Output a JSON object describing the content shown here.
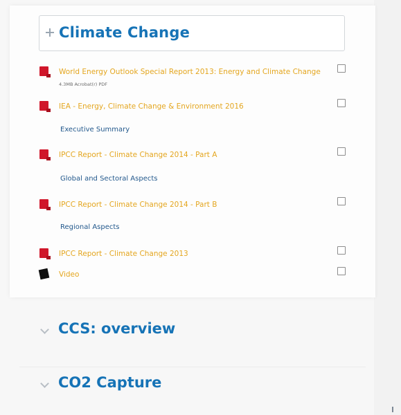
{
  "sections": {
    "climate_change": {
      "title": "Climate Change",
      "documents": [
        {
          "title": "World Energy Outlook Special Report 2013: Energy and Climate Change",
          "meta": "4.3MB Acrobat(r) PDF"
        },
        {
          "title": "IEA - Energy, Climate Change & Environment 2016",
          "subtitle": "Executive Summary"
        },
        {
          "title": "IPCC Report - Climate Change 2014 - Part A",
          "subtitle": "Global and Sectoral Aspects"
        },
        {
          "title": "IPCC Report - Climate Change 2014 - Part B",
          "subtitle": "Regional Aspects"
        },
        {
          "title": "IPCC Report - Climate Change 2013"
        },
        {
          "title": "Video"
        }
      ]
    },
    "ccs_overview": {
      "title": "CCS: overview"
    },
    "co2_capture": {
      "title": "CO2 Capture"
    }
  },
  "colors": {
    "section_title": "#1673b6",
    "document_link": "#e4a61f",
    "subtitle": "#22588c",
    "pdf_icon": "#d0162a",
    "video_icon": "#101010"
  },
  "icons": {
    "expanded": "plus-toggle-icon",
    "collapsed": "chevron-icon",
    "document": "pdf-icon",
    "video": "video-icon"
  }
}
